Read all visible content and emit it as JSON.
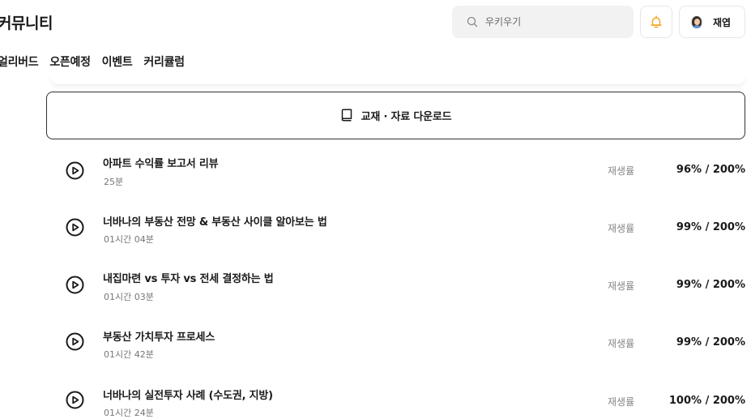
{
  "header": {
    "brand": "커뮤니티",
    "search": {
      "placeholder": "우키우기",
      "icon": "search-icon"
    },
    "notification": {
      "icon": "bell-icon",
      "color": "#f5a623"
    },
    "user": {
      "name": "재엽",
      "icon": "avatar"
    }
  },
  "nav": {
    "tabs": [
      {
        "label": "얼리버드"
      },
      {
        "label": "오픈예정"
      },
      {
        "label": "이벤트"
      },
      {
        "label": "커리큘럼"
      }
    ]
  },
  "download": {
    "label": "교재 · 자료 다운로드",
    "icon": "book-icon"
  },
  "lectures": [
    {
      "title": "아파트 수익률 보고서 리뷰",
      "duration": "25분",
      "rate_label": "재생률",
      "rate_value": "96% / 200%"
    },
    {
      "title": "너바나의 부동산 전망 & 부동산 사이클 알아보는 법",
      "duration": "01시간 04분",
      "rate_label": "재생률",
      "rate_value": "99% / 200%"
    },
    {
      "title": "내집마련 vs 투자 vs 전세 결정하는 법",
      "duration": "01시간 03분",
      "rate_label": "재생률",
      "rate_value": "99% / 200%"
    },
    {
      "title": "부동산 가치투자 프로세스",
      "duration": "01시간 42분",
      "rate_label": "재생률",
      "rate_value": "99% / 200%"
    },
    {
      "title": "너바나의 실전투자 사례 (수도권, 지방)",
      "duration": "01시간 24분",
      "rate_label": "재생률",
      "rate_value": "100% / 200%"
    }
  ]
}
